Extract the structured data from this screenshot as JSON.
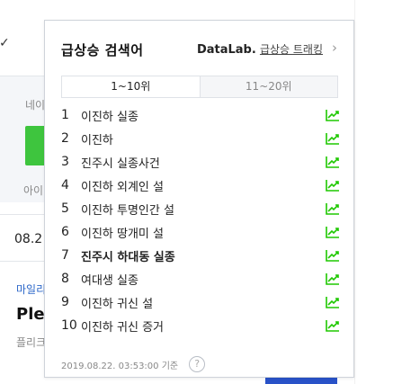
{
  "background": {
    "check_glyph": "✓",
    "label_top": "네이",
    "label_bottom": "아이",
    "date": "08.2",
    "link": "마일리",
    "title": "Plea",
    "sub": "플리크"
  },
  "popup": {
    "title": "급상승 검색어",
    "brand": "DataLab.",
    "trend_link": "급상승 트래킹",
    "chevron": "›",
    "tabs": [
      {
        "label": "1~10위",
        "active": true
      },
      {
        "label": "11~20위",
        "active": false
      }
    ],
    "items": [
      {
        "rank": "1",
        "keyword": "이진하 실종",
        "bold": false
      },
      {
        "rank": "2",
        "keyword": "이진하",
        "bold": false
      },
      {
        "rank": "3",
        "keyword": "진주시 실종사건",
        "bold": false
      },
      {
        "rank": "4",
        "keyword": "이진하 외계인 설",
        "bold": false
      },
      {
        "rank": "5",
        "keyword": "이진하 투명인간 설",
        "bold": false
      },
      {
        "rank": "6",
        "keyword": "이진하 땅개미 설",
        "bold": false
      },
      {
        "rank": "7",
        "keyword": "진주시 하대동 실종",
        "bold": true
      },
      {
        "rank": "8",
        "keyword": "여대생 실종",
        "bold": false
      },
      {
        "rank": "9",
        "keyword": "이진하 귀신 설",
        "bold": false
      },
      {
        "rank": "10",
        "keyword": "이진하 귀신 증거",
        "bold": false
      }
    ],
    "footer_time": "2019.08.22. 03:53:00 기준",
    "help_glyph": "?",
    "trend_icon": "trend-chart-icon",
    "trend_color": "#1ec800"
  }
}
